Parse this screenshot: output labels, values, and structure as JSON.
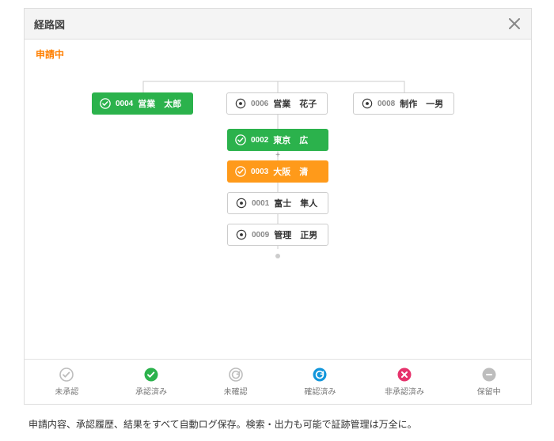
{
  "modal": {
    "title": "経路図",
    "status_label": "申請中"
  },
  "nodes": {
    "n1": {
      "num": "0004",
      "name": "営業　太郎"
    },
    "n2": {
      "num": "0006",
      "name": "営業　花子"
    },
    "n3": {
      "num": "0008",
      "name": "制作　一男"
    },
    "n4": {
      "num": "0002",
      "name": "東京　広"
    },
    "n5": {
      "num": "0003",
      "name": "大阪　清"
    },
    "n6": {
      "num": "0001",
      "name": "富士　隼人"
    },
    "n7": {
      "num": "0009",
      "name": "管理　正男"
    }
  },
  "plus": "+",
  "legend": {
    "l1": "未承認",
    "l2": "承認済み",
    "l3": "未確認",
    "l4": "確認済み",
    "l5": "非承認済み",
    "l6": "保留中"
  },
  "caption": "申請内容、承認履歴、結果をすべて自動ログ保存。検索・出力も可能で証跡管理は万全に。",
  "colors": {
    "green": "#2bb24c",
    "orange": "#ff9a1a",
    "blue": "#1296db",
    "red": "#e6336c",
    "gray": "#bdbdbd"
  }
}
